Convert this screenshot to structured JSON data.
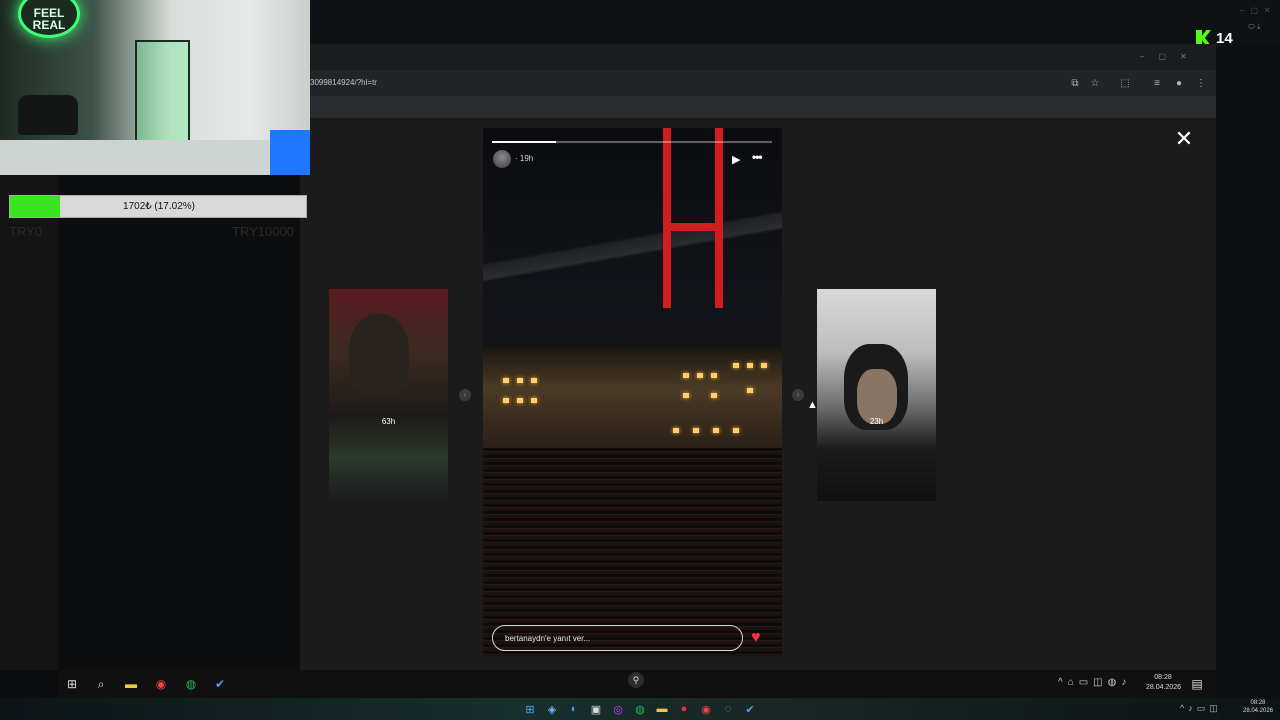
{
  "stream": {
    "viewer_count": "14",
    "platform_logo": "K"
  },
  "facecam": {
    "neon_text": "FEEL REAL"
  },
  "goal": {
    "text": "1702₺ (17.02%)",
    "progress_fraction": 0.1702,
    "min_label": "TRY0",
    "max_label": "TRY10000",
    "fill_color": "#39e51f"
  },
  "browser": {
    "url": "3099814924/?hl=tr"
  },
  "story": {
    "time_ago": "19h",
    "reply_placeholder": "bertanaydn'e yanıt ver...",
    "progress_fraction": 0.23,
    "left_story_time": "63h",
    "right_story_time": "23h",
    "heart_color": "#ff3040",
    "icons": {
      "play": "play-icon",
      "more": "more-icon",
      "close": "close-icon",
      "heart": "heart-icon"
    }
  },
  "inner_taskbar": {
    "time": "08:28",
    "date": "28.04.2026"
  },
  "host_taskbar": {
    "time": "08:28",
    "date": "28.04.2026"
  }
}
